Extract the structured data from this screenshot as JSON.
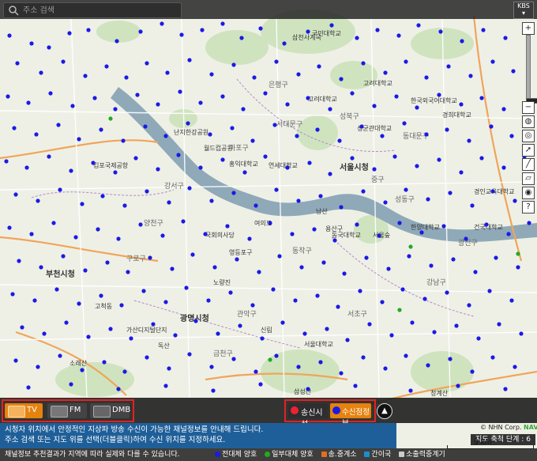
{
  "search": {
    "placeholder": "주소 검색"
  },
  "kbs_logo": "KBS",
  "toolbar": {
    "zoom_in": "+",
    "zoom_out": "−",
    "help": "?",
    "zoom_level_fraction": 0.88
  },
  "media_tabs": [
    {
      "label": "TV",
      "active": true,
      "icon": "tv-icon"
    },
    {
      "label": "FM",
      "active": false,
      "icon": "radio-icon"
    },
    {
      "label": "DMB",
      "active": false,
      "icon": "dmb-icon"
    }
  ],
  "facility_toggles": [
    {
      "label": "송신시설",
      "icon": "transmitter-icon"
    },
    {
      "label": "수신점정보",
      "icon": "blue-dot-icon",
      "active": true
    }
  ],
  "info_lines": [
    "시청자 위치에서 안정적인 지상파 방송 수신이 가능한 채널정보를 안내해 드립니다.",
    "주소 검색 또는 지도 위를 선택(더블클릭)하여 수신 위치를 지정하세요."
  ],
  "footer_note": "채널정보 추천결과가 지역에 따라 실제와 다를 수 있습니다.",
  "legend": [
    {
      "label": "전대체 양호",
      "color": "#1a1ae6"
    },
    {
      "label": "일부대체 양호",
      "color": "#22aa22"
    },
    {
      "label": "송.중계소",
      "color": "#e07020"
    },
    {
      "label": "간이국",
      "color": "#1a8fd0"
    },
    {
      "label": "소출력중계기",
      "color": "#cccccc"
    }
  ],
  "map_zoom_text": "지도 축척 단계 : 6",
  "scale_text": "5 km",
  "copyright": {
    "prefix": "© NHN Corp.",
    "brand": "NAVER"
  },
  "colors": {
    "reception_point": "#1a1ae6",
    "partial_point": "#22aa22",
    "river": "#8fa9b8",
    "highlight": "#e32222",
    "active_tab": "#e6820e"
  },
  "map_labels": [
    "부천시청",
    "광명시청",
    "서울시청",
    "김포국제공항",
    "강서구",
    "양천구",
    "영등포구",
    "동작구",
    "중구",
    "용산구",
    "마포구",
    "서대문구",
    "은평구",
    "성북구",
    "동대문구",
    "성동구",
    "광진구",
    "강남구",
    "서초구",
    "관악구",
    "금천구",
    "구로구",
    "서울대학교",
    "홍익대학교",
    "연세대학교",
    "고려대학교",
    "한국외국어대학교",
    "서울숲",
    "여의도",
    "국회의사당",
    "월드컵공원",
    "난지한강공원",
    "삼천사계곡",
    "국민대학교",
    "성균관대학교",
    "고려대학교",
    "경희대학교",
    "경인교육대학교",
    "소래산",
    "삼성산",
    "청계산",
    "남산",
    "한양대학교",
    "건국대학교",
    "동국대학교",
    "노량진",
    "신림",
    "독산",
    "가산디지털단지",
    "고척동"
  ],
  "reception_points": [
    [
      12,
      45
    ],
    [
      40,
      55
    ],
    [
      62,
      60
    ],
    [
      88,
      42
    ],
    [
      112,
      38
    ],
    [
      148,
      52
    ],
    [
      178,
      40
    ],
    [
      205,
      30
    ],
    [
      230,
      44
    ],
    [
      256,
      38
    ],
    [
      282,
      30
    ],
    [
      306,
      48
    ],
    [
      330,
      36
    ],
    [
      360,
      55
    ],
    [
      390,
      40
    ],
    [
      420,
      32
    ],
    [
      452,
      48
    ],
    [
      478,
      38
    ],
    [
      505,
      45
    ],
    [
      530,
      32
    ],
    [
      558,
      40
    ],
    [
      585,
      52
    ],
    [
      612,
      38
    ],
    [
      640,
      48
    ],
    [
      22,
      80
    ],
    [
      52,
      92
    ],
    [
      80,
      78
    ],
    [
      108,
      96
    ],
    [
      135,
      84
    ],
    [
      160,
      98
    ],
    [
      186,
      80
    ],
    [
      212,
      92
    ],
    [
      240,
      76
    ],
    [
      268,
      94
    ],
    [
      296,
      82
    ],
    [
      322,
      98
    ],
    [
      350,
      78
    ],
    [
      378,
      94
    ],
    [
      404,
      84
    ],
    [
      432,
      100
    ],
    [
      460,
      80
    ],
    [
      488,
      92
    ],
    [
      514,
      78
    ],
    [
      540,
      98
    ],
    [
      568,
      84
    ],
    [
      596,
      96
    ],
    [
      624,
      78
    ],
    [
      650,
      90
    ],
    [
      10,
      122
    ],
    [
      36,
      130
    ],
    [
      64,
      118
    ],
    [
      92,
      134
    ],
    [
      120,
      124
    ],
    [
      146,
      138
    ],
    [
      174,
      120
    ],
    [
      200,
      132
    ],
    [
      228,
      116
    ],
    [
      254,
      130
    ],
    [
      282,
      122
    ],
    [
      308,
      138
    ],
    [
      336,
      118
    ],
    [
      364,
      132
    ],
    [
      390,
      124
    ],
    [
      418,
      138
    ],
    [
      446,
      118
    ],
    [
      474,
      134
    ],
    [
      502,
      122
    ],
    [
      528,
      136
    ],
    [
      556,
      120
    ],
    [
      584,
      132
    ],
    [
      610,
      124
    ],
    [
      638,
      138
    ],
    [
      18,
      162
    ],
    [
      46,
      170
    ],
    [
      74,
      158
    ],
    [
      100,
      176
    ],
    [
      128,
      164
    ],
    [
      156,
      178
    ],
    [
      184,
      160
    ],
    [
      210,
      172
    ],
    [
      238,
      156
    ],
    [
      266,
      170
    ],
    [
      294,
      162
    ],
    [
      320,
      178
    ],
    [
      348,
      158
    ],
    [
      376,
      172
    ],
    [
      402,
      164
    ],
    [
      430,
      178
    ],
    [
      458,
      160
    ],
    [
      484,
      172
    ],
    [
      512,
      156
    ],
    [
      540,
      170
    ],
    [
      566,
      164
    ],
    [
      594,
      178
    ],
    [
      622,
      160
    ],
    [
      648,
      172
    ],
    [
      8,
      204
    ],
    [
      34,
      212
    ],
    [
      62,
      198
    ],
    [
      90,
      216
    ],
    [
      118,
      206
    ],
    [
      146,
      218
    ],
    [
      172,
      200
    ],
    [
      200,
      214
    ],
    [
      226,
      196
    ],
    [
      254,
      212
    ],
    [
      282,
      202
    ],
    [
      310,
      218
    ],
    [
      336,
      198
    ],
    [
      364,
      212
    ],
    [
      392,
      206
    ],
    [
      418,
      220
    ],
    [
      446,
      200
    ],
    [
      474,
      214
    ],
    [
      500,
      198
    ],
    [
      528,
      210
    ],
    [
      556,
      202
    ],
    [
      584,
      218
    ],
    [
      610,
      200
    ],
    [
      638,
      212
    ],
    [
      664,
      198
    ],
    [
      20,
      246
    ],
    [
      48,
      254
    ],
    [
      76,
      240
    ],
    [
      104,
      258
    ],
    [
      130,
      248
    ],
    [
      158,
      260
    ],
    [
      186,
      242
    ],
    [
      214,
      256
    ],
    [
      240,
      238
    ],
    [
      268,
      254
    ],
    [
      296,
      244
    ],
    [
      324,
      260
    ],
    [
      350,
      240
    ],
    [
      378,
      254
    ],
    [
      406,
      248
    ],
    [
      432,
      262
    ],
    [
      460,
      242
    ],
    [
      488,
      256
    ],
    [
      514,
      240
    ],
    [
      542,
      252
    ],
    [
      570,
      244
    ],
    [
      598,
      260
    ],
    [
      624,
      242
    ],
    [
      652,
      254
    ],
    [
      12,
      288
    ],
    [
      40,
      296
    ],
    [
      68,
      282
    ],
    [
      96,
      300
    ],
    [
      124,
      290
    ],
    [
      150,
      302
    ],
    [
      178,
      284
    ],
    [
      206,
      298
    ],
    [
      232,
      280
    ],
    [
      260,
      296
    ],
    [
      288,
      286
    ],
    [
      316,
      302
    ],
    [
      342,
      282
    ],
    [
      370,
      296
    ],
    [
      398,
      290
    ],
    [
      424,
      304
    ],
    [
      452,
      284
    ],
    [
      480,
      298
    ],
    [
      506,
      282
    ],
    [
      534,
      294
    ],
    [
      562,
      286
    ],
    [
      590,
      302
    ],
    [
      616,
      284
    ],
    [
      644,
      296
    ],
    [
      670,
      282
    ],
    [
      24,
      330
    ],
    [
      52,
      338
    ],
    [
      80,
      324
    ],
    [
      108,
      342
    ],
    [
      136,
      332
    ],
    [
      162,
      344
    ],
    [
      190,
      326
    ],
    [
      218,
      340
    ],
    [
      244,
      322
    ],
    [
      272,
      338
    ],
    [
      300,
      328
    ],
    [
      328,
      344
    ],
    [
      354,
      324
    ],
    [
      382,
      338
    ],
    [
      410,
      332
    ],
    [
      436,
      346
    ],
    [
      464,
      326
    ],
    [
      492,
      340
    ],
    [
      518,
      324
    ],
    [
      546,
      336
    ],
    [
      574,
      328
    ],
    [
      602,
      344
    ],
    [
      628,
      326
    ],
    [
      656,
      338
    ],
    [
      16,
      372
    ],
    [
      44,
      380
    ],
    [
      72,
      366
    ],
    [
      100,
      384
    ],
    [
      128,
      374
    ],
    [
      154,
      386
    ],
    [
      182,
      368
    ],
    [
      210,
      382
    ],
    [
      236,
      364
    ],
    [
      264,
      380
    ],
    [
      292,
      370
    ],
    [
      320,
      386
    ],
    [
      346,
      366
    ],
    [
      374,
      380
    ],
    [
      402,
      374
    ],
    [
      428,
      388
    ],
    [
      456,
      368
    ],
    [
      484,
      382
    ],
    [
      510,
      366
    ],
    [
      538,
      378
    ],
    [
      566,
      370
    ],
    [
      594,
      386
    ],
    [
      620,
      368
    ],
    [
      648,
      380
    ],
    [
      28,
      414
    ],
    [
      56,
      422
    ],
    [
      84,
      408
    ],
    [
      112,
      426
    ],
    [
      140,
      416
    ],
    [
      166,
      428
    ],
    [
      194,
      410
    ],
    [
      222,
      424
    ],
    [
      248,
      406
    ],
    [
      276,
      422
    ],
    [
      304,
      412
    ],
    [
      332,
      428
    ],
    [
      358,
      408
    ],
    [
      386,
      422
    ],
    [
      414,
      416
    ],
    [
      440,
      430
    ],
    [
      468,
      410
    ],
    [
      496,
      424
    ],
    [
      522,
      408
    ],
    [
      550,
      420
    ],
    [
      578,
      412
    ],
    [
      606,
      428
    ],
    [
      632,
      410
    ],
    [
      660,
      422
    ],
    [
      20,
      456
    ],
    [
      48,
      464
    ],
    [
      76,
      450
    ],
    [
      104,
      468
    ],
    [
      132,
      458
    ],
    [
      158,
      470
    ],
    [
      186,
      452
    ],
    [
      214,
      466
    ],
    [
      240,
      448
    ],
    [
      268,
      464
    ],
    [
      296,
      454
    ],
    [
      324,
      470
    ],
    [
      350,
      450
    ],
    [
      378,
      464
    ],
    [
      406,
      458
    ],
    [
      432,
      472
    ],
    [
      460,
      452
    ],
    [
      488,
      466
    ],
    [
      514,
      450
    ],
    [
      542,
      462
    ],
    [
      570,
      454
    ],
    [
      598,
      470
    ],
    [
      624,
      452
    ],
    [
      652,
      464
    ],
    [
      36,
      490
    ],
    [
      90,
      486
    ],
    [
      150,
      492
    ],
    [
      210,
      488
    ],
    [
      270,
      494
    ],
    [
      330,
      486
    ],
    [
      390,
      492
    ],
    [
      450,
      488
    ],
    [
      520,
      494
    ],
    [
      580,
      488
    ],
    [
      640,
      492
    ]
  ],
  "partial_points": [
    [
      140,
      150
    ],
    [
      520,
      312
    ],
    [
      342,
      455
    ],
    [
      506,
      392
    ],
    [
      656,
      321
    ]
  ]
}
